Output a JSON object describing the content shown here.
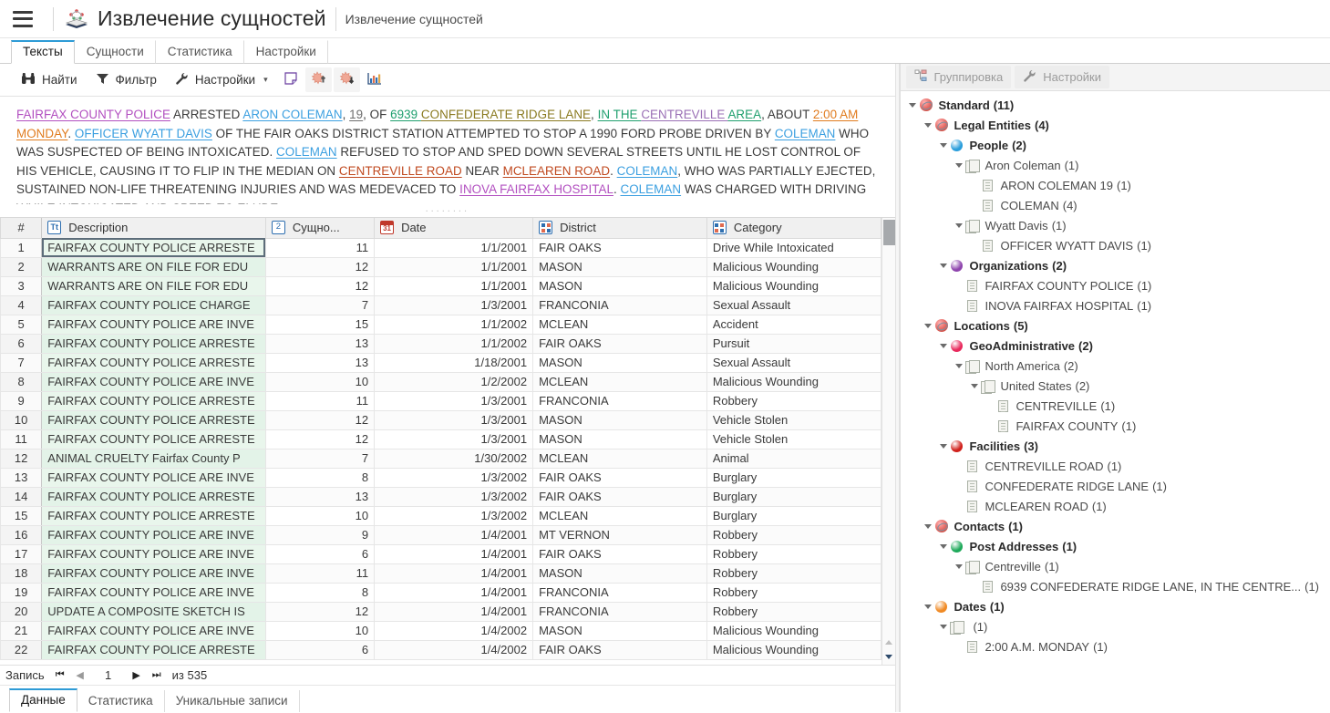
{
  "titlebar": {
    "menu_icon": "hamburger-icon",
    "app_icon": "entity-extraction-icon",
    "title": "Извлечение сущностей",
    "subtitle": "Извлечение сущностей"
  },
  "tabs": [
    {
      "label": "Тексты",
      "active": true
    },
    {
      "label": "Сущности",
      "active": false
    },
    {
      "label": "Статистика",
      "active": false
    },
    {
      "label": "Настройки",
      "active": false
    }
  ],
  "toolbar": {
    "find_label": "Найти",
    "filter_label": "Фильтр",
    "settings_label": "Настройки",
    "caret": "▾",
    "note_icon": "note-icon",
    "burst_up_icon": "burst-up-icon",
    "burst_down_icon": "burst-down-icon",
    "chart_icon": "bar-chart-icon"
  },
  "text": {
    "segments": [
      {
        "t": "FAIRFAX COUNTY POLICE",
        "c": "e-org"
      },
      {
        "t": " ARRESTED ",
        "c": ""
      },
      {
        "t": "ARON COLEMAN",
        "c": "e-per"
      },
      {
        "t": ", ",
        "c": ""
      },
      {
        "t": "19",
        "c": "e-num"
      },
      {
        "t": ", OF ",
        "c": ""
      },
      {
        "t": "6939 ",
        "c": "e-geo"
      },
      {
        "t": "CONFEDERATE RIDGE LANE",
        "c": "e-fac2"
      },
      {
        "t": ", ",
        "c": ""
      },
      {
        "t": "IN THE ",
        "c": "e-geo"
      },
      {
        "t": "CENTREVILLE ",
        "c": "e-geo2"
      },
      {
        "t": "AREA",
        "c": "e-geo"
      },
      {
        "t": ", ABOUT ",
        "c": ""
      },
      {
        "t": "2:00 AM MONDAY",
        "c": "e-date"
      },
      {
        "t": ". ",
        "c": ""
      },
      {
        "t": "OFFICER WYATT DAVIS",
        "c": "e-per"
      },
      {
        "t": " OF THE FAIR OAKS DISTRICT STATION ATTEMPTED TO STOP A 1990 FORD PROBE DRIVEN BY ",
        "c": ""
      },
      {
        "t": "COLEMAN",
        "c": "e-per"
      },
      {
        "t": " WHO WAS SUSPECTED OF BEING INTOXICATED. ",
        "c": ""
      },
      {
        "t": "COLEMAN",
        "c": "e-per"
      },
      {
        "t": " REFUSED TO STOP AND SPED DOWN SEVERAL STREETS UNTIL HE LOST CONTROL OF HIS VEHICLE, CAUSING IT TO FLIP IN THE MEDIAN ON ",
        "c": ""
      },
      {
        "t": "CENTREVILLE ROAD",
        "c": "e-fac"
      },
      {
        "t": " NEAR ",
        "c": ""
      },
      {
        "t": "MCLEAREN ROAD",
        "c": "e-fac"
      },
      {
        "t": ". ",
        "c": ""
      },
      {
        "t": "COLEMAN",
        "c": "e-per"
      },
      {
        "t": ", WHO WAS PARTIALLY EJECTED, SUSTAINED NON-LIFE THREATENING INJURIES AND WAS MEDEVACED TO ",
        "c": ""
      },
      {
        "t": "INOVA FAIRFAX HOSPITAL",
        "c": "e-org"
      },
      {
        "t": ". ",
        "c": ""
      },
      {
        "t": "COLEMAN",
        "c": "e-per"
      },
      {
        "t": " WAS CHARGED WITH DRIVING WHILE INTOXICATED AND SPEED TO ELUDE.",
        "c": ""
      }
    ]
  },
  "grid": {
    "columns": [
      {
        "key": "num",
        "label": "#",
        "icon": ""
      },
      {
        "key": "desc",
        "label": "Description",
        "icon": "text-type-icon"
      },
      {
        "key": "cnt",
        "label": "Сущно...",
        "icon": "number-type-icon"
      },
      {
        "key": "date",
        "label": "Date",
        "icon": "calendar-type-icon"
      },
      {
        "key": "dist",
        "label": "District",
        "icon": "category-type-icon"
      },
      {
        "key": "cat",
        "label": "Category",
        "icon": "category-type-icon"
      }
    ],
    "rows": [
      {
        "num": "1",
        "desc": "FAIRFAX COUNTY POLICE ARRESTE",
        "cnt": "11",
        "date": "1/1/2001",
        "dist": "FAIR OAKS",
        "cat": "Drive While Intoxicated",
        "selected": true
      },
      {
        "num": "2",
        "desc": "WARRANTS ARE ON FILE FOR EDU",
        "cnt": "12",
        "date": "1/1/2001",
        "dist": "MASON",
        "cat": "Malicious Wounding"
      },
      {
        "num": "3",
        "desc": "WARRANTS ARE ON FILE FOR EDU",
        "cnt": "12",
        "date": "1/1/2001",
        "dist": "MASON",
        "cat": "Malicious Wounding"
      },
      {
        "num": "4",
        "desc": "FAIRFAX COUNTY POLICE CHARGE",
        "cnt": "7",
        "date": "1/3/2001",
        "dist": "FRANCONIA",
        "cat": "Sexual Assault"
      },
      {
        "num": "5",
        "desc": "FAIRFAX COUNTY POLICE ARE INVE",
        "cnt": "15",
        "date": "1/1/2002",
        "dist": "MCLEAN",
        "cat": "Accident"
      },
      {
        "num": "6",
        "desc": "FAIRFAX COUNTY POLICE ARRESTE",
        "cnt": "13",
        "date": "1/1/2002",
        "dist": "FAIR OAKS",
        "cat": "Pursuit"
      },
      {
        "num": "7",
        "desc": "FAIRFAX COUNTY POLICE ARRESTE",
        "cnt": "13",
        "date": "1/18/2001",
        "dist": "MASON",
        "cat": "Sexual Assault"
      },
      {
        "num": "8",
        "desc": "FAIRFAX COUNTY POLICE ARE INVE",
        "cnt": "10",
        "date": "1/2/2002",
        "dist": "MCLEAN",
        "cat": "Malicious Wounding"
      },
      {
        "num": "9",
        "desc": "FAIRFAX COUNTY POLICE ARRESTE",
        "cnt": "11",
        "date": "1/3/2001",
        "dist": "FRANCONIA",
        "cat": "Robbery"
      },
      {
        "num": "10",
        "desc": "FAIRFAX COUNTY POLICE ARRESTE",
        "cnt": "12",
        "date": "1/3/2001",
        "dist": "MASON",
        "cat": "Vehicle Stolen"
      },
      {
        "num": "11",
        "desc": "FAIRFAX COUNTY POLICE ARRESTE",
        "cnt": "12",
        "date": "1/3/2001",
        "dist": "MASON",
        "cat": "Vehicle Stolen"
      },
      {
        "num": "12",
        "desc": "ANIMAL CRUELTY Fairfax County P",
        "cnt": "7",
        "date": "1/30/2002",
        "dist": "MCLEAN",
        "cat": "Animal"
      },
      {
        "num": "13",
        "desc": "FAIRFAX COUNTY POLICE ARE INVE",
        "cnt": "8",
        "date": "1/3/2002",
        "dist": "FAIR OAKS",
        "cat": "Burglary"
      },
      {
        "num": "14",
        "desc": "FAIRFAX COUNTY POLICE ARRESTE",
        "cnt": "13",
        "date": "1/3/2002",
        "dist": "FAIR OAKS",
        "cat": "Burglary"
      },
      {
        "num": "15",
        "desc": "FAIRFAX COUNTY POLICE ARRESTE",
        "cnt": "10",
        "date": "1/3/2002",
        "dist": "MCLEAN",
        "cat": "Burglary"
      },
      {
        "num": "16",
        "desc": "FAIRFAX COUNTY POLICE ARE INVE",
        "cnt": "9",
        "date": "1/4/2001",
        "dist": "MT VERNON",
        "cat": "Robbery"
      },
      {
        "num": "17",
        "desc": "FAIRFAX COUNTY POLICE ARE INVE",
        "cnt": "6",
        "date": "1/4/2001",
        "dist": "FAIR OAKS",
        "cat": "Robbery"
      },
      {
        "num": "18",
        "desc": "FAIRFAX COUNTY POLICE ARE INVE",
        "cnt": "11",
        "date": "1/4/2001",
        "dist": "MASON",
        "cat": "Robbery"
      },
      {
        "num": "19",
        "desc": "FAIRFAX COUNTY POLICE ARE INVE",
        "cnt": "8",
        "date": "1/4/2001",
        "dist": "FRANCONIA",
        "cat": "Robbery"
      },
      {
        "num": "20",
        "desc": "UPDATE A COMPOSITE SKETCH IS",
        "cnt": "12",
        "date": "1/4/2001",
        "dist": "FRANCONIA",
        "cat": "Robbery"
      },
      {
        "num": "21",
        "desc": "FAIRFAX COUNTY POLICE ARE INVE",
        "cnt": "10",
        "date": "1/4/2002",
        "dist": "MASON",
        "cat": "Malicious Wounding"
      },
      {
        "num": "22",
        "desc": "FAIRFAX COUNTY POLICE ARRESTE",
        "cnt": "6",
        "date": "1/4/2002",
        "dist": "FAIR OAKS",
        "cat": "Malicious Wounding"
      }
    ]
  },
  "recnav": {
    "label": "Запись",
    "first": "⏮",
    "prev": "◀",
    "page": "1",
    "next": "▶",
    "last": "⏭",
    "total": "из 535"
  },
  "bottom_tabs": [
    {
      "label": "Данные",
      "active": true
    },
    {
      "label": "Статистика",
      "active": false
    },
    {
      "label": "Уникальные записи",
      "active": false
    }
  ],
  "right_toolbar": {
    "group_label": "Группировка",
    "group_icon": "grouping-icon",
    "settings_label": "Настройки",
    "settings_icon": "wrench-icon"
  },
  "tree": [
    {
      "indent": 0,
      "twist": true,
      "icon": "ring",
      "color": "#c0392b",
      "label": "Standard",
      "count": "(11)",
      "bold": true
    },
    {
      "indent": 1,
      "twist": true,
      "icon": "ring",
      "color": "#c0392b",
      "label": "Legal Entities",
      "count": "(4)",
      "bold": true
    },
    {
      "indent": 2,
      "twist": true,
      "icon": "sphere",
      "color": "#2a9ddb",
      "label": "People",
      "count": "(2)",
      "bold": true
    },
    {
      "indent": 3,
      "twist": true,
      "icon": "docs",
      "color": "",
      "label": "Aron Coleman",
      "count": "(1)",
      "bold": false
    },
    {
      "indent": 4,
      "twist": false,
      "icon": "doc",
      "color": "",
      "label": "ARON COLEMAN 19",
      "count": "(1)",
      "bold": false
    },
    {
      "indent": 4,
      "twist": false,
      "icon": "doc",
      "color": "",
      "label": "COLEMAN",
      "count": "(4)",
      "bold": false
    },
    {
      "indent": 3,
      "twist": true,
      "icon": "docs",
      "color": "",
      "label": "Wyatt Davis",
      "count": "(1)",
      "bold": false
    },
    {
      "indent": 4,
      "twist": false,
      "icon": "doc",
      "color": "",
      "label": "OFFICER WYATT DAVIS",
      "count": "(1)",
      "bold": false
    },
    {
      "indent": 2,
      "twist": true,
      "icon": "sphere",
      "color": "#8e44ad",
      "label": "Organizations",
      "count": "(2)",
      "bold": true
    },
    {
      "indent": 3,
      "twist": false,
      "icon": "doc",
      "color": "",
      "label": "FAIRFAX COUNTY POLICE",
      "count": "(1)",
      "bold": false
    },
    {
      "indent": 3,
      "twist": false,
      "icon": "doc",
      "color": "",
      "label": "INOVA FAIRFAX HOSPITAL",
      "count": "(1)",
      "bold": false
    },
    {
      "indent": 1,
      "twist": true,
      "icon": "ring",
      "color": "#c0392b",
      "label": "Locations",
      "count": "(5)",
      "bold": true
    },
    {
      "indent": 2,
      "twist": true,
      "icon": "sphere",
      "color": "#e8295c",
      "label": "GeoAdministrative",
      "count": "(2)",
      "bold": true
    },
    {
      "indent": 3,
      "twist": true,
      "icon": "docs",
      "color": "",
      "label": "North America",
      "count": "(2)",
      "bold": false
    },
    {
      "indent": 4,
      "twist": true,
      "icon": "docs",
      "color": "",
      "label": "United States",
      "count": "(2)",
      "bold": false
    },
    {
      "indent": 5,
      "twist": false,
      "icon": "doc",
      "color": "",
      "label": "CENTREVILLE",
      "count": "(1)",
      "bold": false
    },
    {
      "indent": 5,
      "twist": false,
      "icon": "doc",
      "color": "",
      "label": "FAIRFAX COUNTY",
      "count": "(1)",
      "bold": false
    },
    {
      "indent": 2,
      "twist": true,
      "icon": "sphere",
      "color": "#d0211c",
      "label": "Facilities",
      "count": "(3)",
      "bold": true
    },
    {
      "indent": 3,
      "twist": false,
      "icon": "doc",
      "color": "",
      "label": "CENTREVILLE ROAD",
      "count": "(1)",
      "bold": false
    },
    {
      "indent": 3,
      "twist": false,
      "icon": "doc",
      "color": "",
      "label": "CONFEDERATE RIDGE LANE",
      "count": "(1)",
      "bold": false
    },
    {
      "indent": 3,
      "twist": false,
      "icon": "doc",
      "color": "",
      "label": "MCLEAREN ROAD",
      "count": "(1)",
      "bold": false
    },
    {
      "indent": 1,
      "twist": true,
      "icon": "ring",
      "color": "#c0392b",
      "label": "Contacts",
      "count": "(1)",
      "bold": true
    },
    {
      "indent": 2,
      "twist": true,
      "icon": "sphere",
      "color": "#1ea95a",
      "label": "Post Addresses",
      "count": "(1)",
      "bold": true
    },
    {
      "indent": 3,
      "twist": true,
      "icon": "docs",
      "color": "",
      "label": "Centreville",
      "count": "(1)",
      "bold": false
    },
    {
      "indent": 4,
      "twist": false,
      "icon": "doc",
      "color": "",
      "label": "6939 CONFEDERATE RIDGE LANE, IN THE CENTRE...",
      "count": "(1)",
      "bold": false,
      "count_far": true
    },
    {
      "indent": 1,
      "twist": true,
      "icon": "sphere",
      "color": "#f08a24",
      "label": "Dates",
      "count": "(1)",
      "bold": true
    },
    {
      "indent": 2,
      "twist": true,
      "icon": "docs",
      "color": "",
      "label": "",
      "count": "(1)",
      "bold": false
    },
    {
      "indent": 3,
      "twist": false,
      "icon": "doc",
      "color": "",
      "label": "2:00 A.M. MONDAY",
      "count": "(1)",
      "bold": false
    }
  ],
  "colors": {
    "accent": "#2e9bd6",
    "desc_cell_bg": "#e9f6ec",
    "header_bg": "#f0f0f0"
  }
}
